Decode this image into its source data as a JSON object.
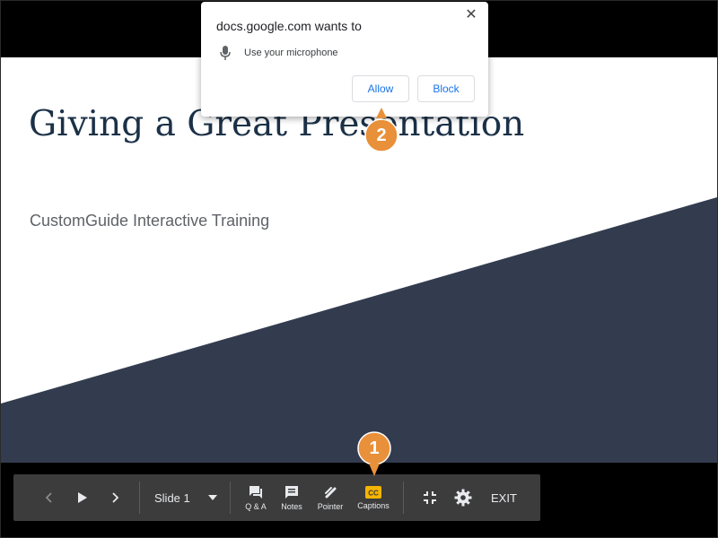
{
  "popup": {
    "title": "docs.google.com wants to",
    "permission": "Use your microphone",
    "allow_label": "Allow",
    "block_label": "Block",
    "close_glyph": "✕"
  },
  "slide": {
    "title": "Giving a Great Presentation",
    "subtitle": "CustomGuide Interactive Training",
    "accent_color": "#333c4f"
  },
  "toolbar": {
    "slide_label": "Slide 1",
    "qa_label": "Q & A",
    "notes_label": "Notes",
    "pointer_label": "Pointer",
    "captions_label": "Captions",
    "exit_label": "EXIT"
  },
  "callouts": {
    "step1": "1",
    "step2": "2",
    "color": "#e8903a"
  },
  "icons": {
    "prev": "chevron-left-icon",
    "play": "play-icon",
    "next": "chevron-right-icon",
    "dropdown": "caret-down-icon",
    "qa": "qa-icon",
    "notes": "notes-icon",
    "pointer": "pointer-icon",
    "captions": "captions-icon",
    "exit_fullscreen": "exit-fullscreen-icon",
    "settings": "gear-icon",
    "microphone": "microphone-icon"
  }
}
